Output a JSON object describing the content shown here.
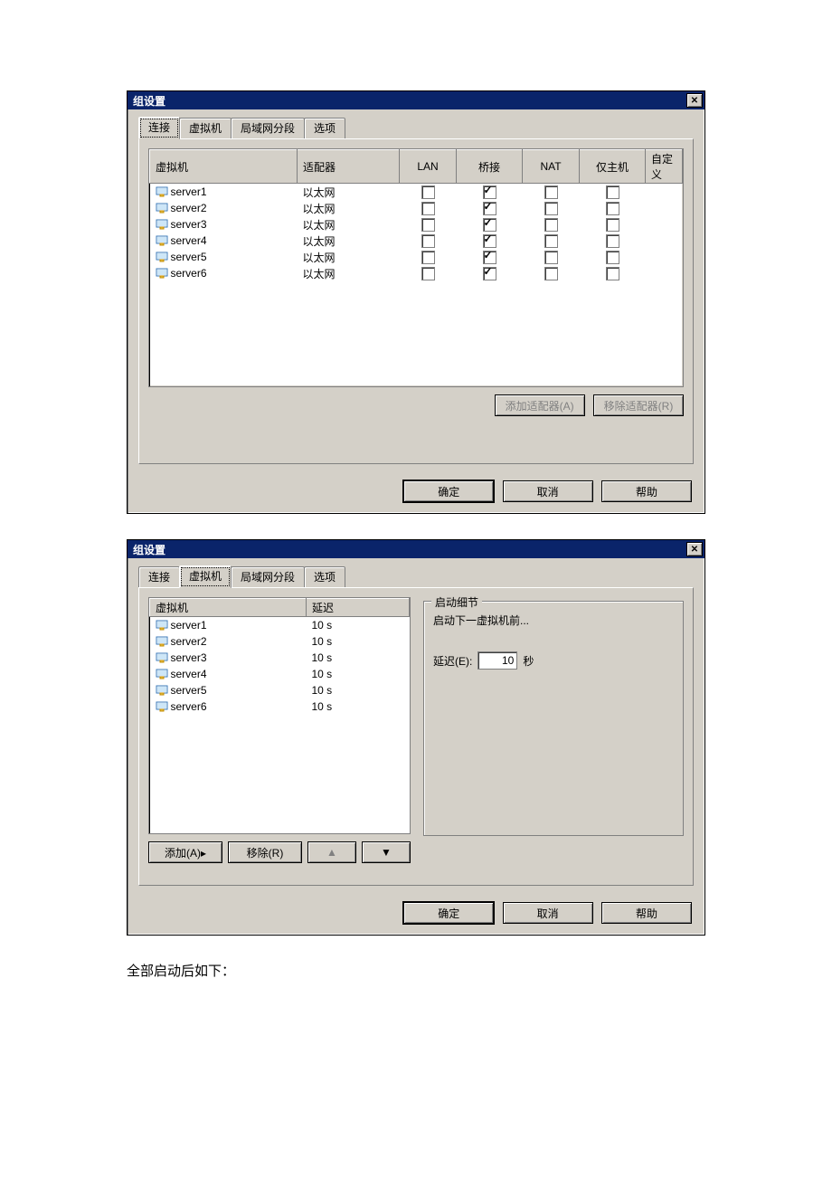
{
  "dialog1": {
    "title": "组设置",
    "tabs": [
      "连接",
      "虚拟机",
      "局域网分段",
      "选项"
    ],
    "active_tab": 0,
    "columns": [
      "虚拟机",
      "适配器",
      "LAN",
      "桥接",
      "NAT",
      "仅主机",
      "自定义"
    ],
    "rows": [
      {
        "name": "server1",
        "adapter": "以太网",
        "lan": false,
        "bridge": true,
        "nat": false,
        "hostonly": false
      },
      {
        "name": "server2",
        "adapter": "以太网",
        "lan": false,
        "bridge": true,
        "nat": false,
        "hostonly": false
      },
      {
        "name": "server3",
        "adapter": "以太网",
        "lan": false,
        "bridge": true,
        "nat": false,
        "hostonly": false
      },
      {
        "name": "server4",
        "adapter": "以太网",
        "lan": false,
        "bridge": true,
        "nat": false,
        "hostonly": false
      },
      {
        "name": "server5",
        "adapter": "以太网",
        "lan": false,
        "bridge": true,
        "nat": false,
        "hostonly": false
      },
      {
        "name": "server6",
        "adapter": "以太网",
        "lan": false,
        "bridge": true,
        "nat": false,
        "hostonly": false
      }
    ],
    "add_adapter": "添加适配器(A)",
    "remove_adapter": "移除适配器(R)",
    "ok": "确定",
    "cancel": "取消",
    "help": "帮助"
  },
  "dialog2": {
    "title": "组设置",
    "tabs": [
      "连接",
      "虚拟机",
      "局域网分段",
      "选项"
    ],
    "active_tab": 1,
    "columns": [
      "虚拟机",
      "延迟"
    ],
    "rows": [
      {
        "name": "server1",
        "delay": "10 s"
      },
      {
        "name": "server2",
        "delay": "10 s"
      },
      {
        "name": "server3",
        "delay": "10 s"
      },
      {
        "name": "server4",
        "delay": "10 s"
      },
      {
        "name": "server5",
        "delay": "10 s"
      },
      {
        "name": "server6",
        "delay": "10 s"
      }
    ],
    "add": "添加(A)▸",
    "remove": "移除(R)",
    "up_icon": "▲",
    "down_icon": "▼",
    "group_title": "启动细节",
    "start_next_label": "启动下一虚拟机前...",
    "delay_label": "延迟(E):",
    "delay_value": "10",
    "delay_unit": "秒",
    "ok": "确定",
    "cancel": "取消",
    "help": "帮助"
  },
  "footer_text": "全部启动后如下："
}
